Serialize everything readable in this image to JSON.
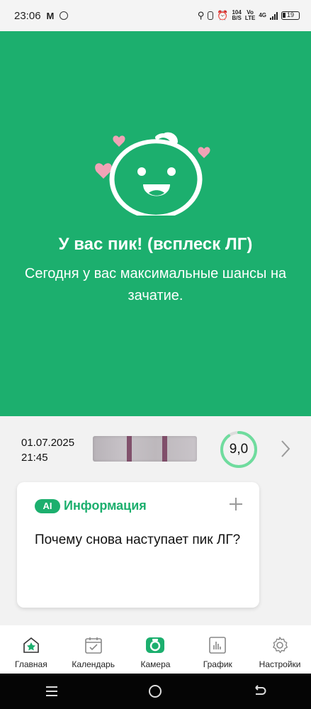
{
  "status_bar": {
    "time": "23:06",
    "net_speed_value": "104",
    "net_speed_unit": "B/S",
    "volte_top": "Vo",
    "volte_bottom": "LTE",
    "network": "4G",
    "battery": "19"
  },
  "hero": {
    "title": "У вас пик! (всплеск ЛГ)",
    "subtitle": "Сегодня у вас максимальные шансы на зачатие.",
    "icon": "happy-baby-face-icon",
    "background": "#1caf6e",
    "heart_color": "#f0a3b6"
  },
  "test_result": {
    "date": "01.07.2025",
    "time": "21:45",
    "score": "9,0",
    "score_fraction": 0.9,
    "score_color": "#6fdc9e"
  },
  "info_card": {
    "badge": "AI",
    "title": "Информация",
    "question": "Почему снова наступает пик ЛГ?",
    "accent": "#1caf6e"
  },
  "bottom_nav": {
    "items": [
      {
        "label": "Главная",
        "icon": "home-star-icon"
      },
      {
        "label": "Календарь",
        "icon": "calendar-check-icon"
      },
      {
        "label": "Камера",
        "icon": "camera-icon"
      },
      {
        "label": "График",
        "icon": "chart-bars-icon"
      },
      {
        "label": "Настройки",
        "icon": "gear-icon"
      }
    ]
  }
}
